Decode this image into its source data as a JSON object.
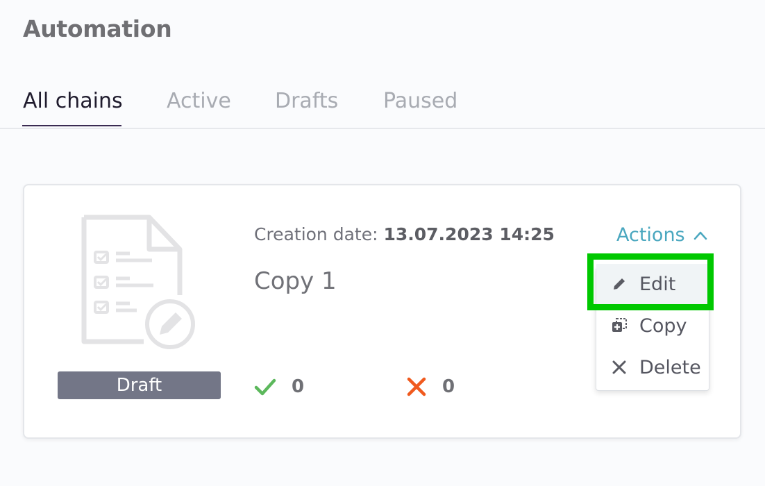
{
  "page": {
    "title": "Automation"
  },
  "tabs": [
    {
      "label": "All chains",
      "active": true
    },
    {
      "label": "Active",
      "active": false
    },
    {
      "label": "Drafts",
      "active": false
    },
    {
      "label": "Paused",
      "active": false
    }
  ],
  "card": {
    "icon": "document-checklist-edit-icon",
    "status": "Draft",
    "creation_date_label": "Creation date:",
    "creation_date_value": "13.07.2023 14:25",
    "name": "Copy 1",
    "stats": {
      "success": {
        "icon": "check-icon",
        "count": "0",
        "color": "#5cb85c"
      },
      "failed": {
        "icon": "cross-icon",
        "count": "0",
        "color": "#f05a1e"
      }
    },
    "actions": {
      "label": "Actions",
      "expanded": true,
      "items": [
        {
          "label": "Edit",
          "icon": "pencil-icon",
          "highlighted": true
        },
        {
          "label": "Copy",
          "icon": "copy-icon"
        },
        {
          "label": "Delete",
          "icon": "close-icon"
        }
      ]
    }
  },
  "colors": {
    "accent": "#4aa7bf",
    "highlight": "#00c800",
    "badge": "#737687"
  }
}
